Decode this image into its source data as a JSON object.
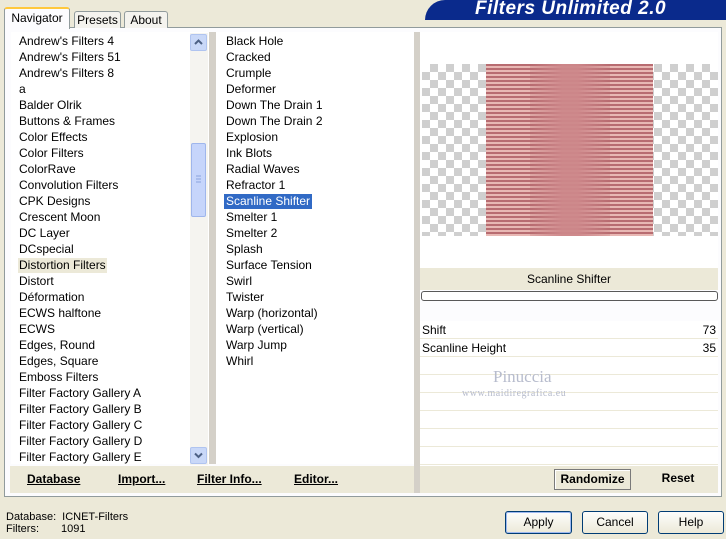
{
  "window": {
    "brand": "Filters Unlimited 2.0"
  },
  "tabs": [
    {
      "label": "Navigator"
    },
    {
      "label": "Presets"
    },
    {
      "label": "About"
    }
  ],
  "categories": [
    "Andrew's Filters 4",
    "Andrew's Filters 51",
    "Andrew's Filters 8",
    "a",
    "Balder Olrik",
    "Buttons & Frames",
    "Color Effects",
    "Color Filters",
    "ColorRave",
    "Convolution Filters",
    "CPK Designs",
    "Crescent Moon",
    "DC Layer",
    "DCspecial",
    "Distortion Filters",
    "Distort",
    "Déformation",
    "ECWS halftone",
    "ECWS",
    "Edges, Round",
    "Edges, Square",
    "Emboss Filters",
    "Filter Factory Gallery A",
    "Filter Factory Gallery B",
    "Filter Factory Gallery C",
    "Filter Factory Gallery D",
    "Filter Factory Gallery E"
  ],
  "selected_category": "Distortion Filters",
  "filters": [
    "Black Hole",
    "Cracked",
    "Crumple",
    "Deformer",
    "Down The Drain 1",
    "Down The Drain 2",
    "Explosion",
    "Ink Blots",
    "Radial Waves",
    "Refractor 1",
    "Scanline Shifter",
    "Smelter 1",
    "Smelter 2",
    "Splash",
    "Surface Tension",
    "Swirl",
    "Twister",
    "Warp (horizontal)",
    "Warp (vertical)",
    "Warp Jump",
    "Whirl"
  ],
  "selected_filter": "Scanline Shifter",
  "preview": {
    "filter_name": "Scanline Shifter",
    "colors": {
      "stripe_dark": "#b86c71",
      "stripe_light": "#e8b8b4"
    }
  },
  "params": [
    {
      "label": "Shift",
      "value": "73"
    },
    {
      "label": "Scanline Height",
      "value": "35"
    }
  ],
  "watermark": {
    "name": "Pinuccia",
    "url": "www.maidiregrafica.eu"
  },
  "left_buttons": {
    "database": "Database",
    "import": "Import...",
    "filter_info": "Filter Info...",
    "editor": "Editor..."
  },
  "right_buttons": {
    "randomize": "Randomize",
    "reset": "Reset"
  },
  "status": {
    "database_label": "Database:",
    "database_value": "ICNET-Filters",
    "filters_label": "Filters:",
    "filters_value": "1091"
  },
  "dialog_buttons": {
    "apply": "Apply",
    "cancel": "Cancel",
    "help": "Help"
  },
  "colors": {
    "brand_bg": "#0a2a8c",
    "selection": "#316ac5",
    "dialog": "#ece9d8"
  }
}
